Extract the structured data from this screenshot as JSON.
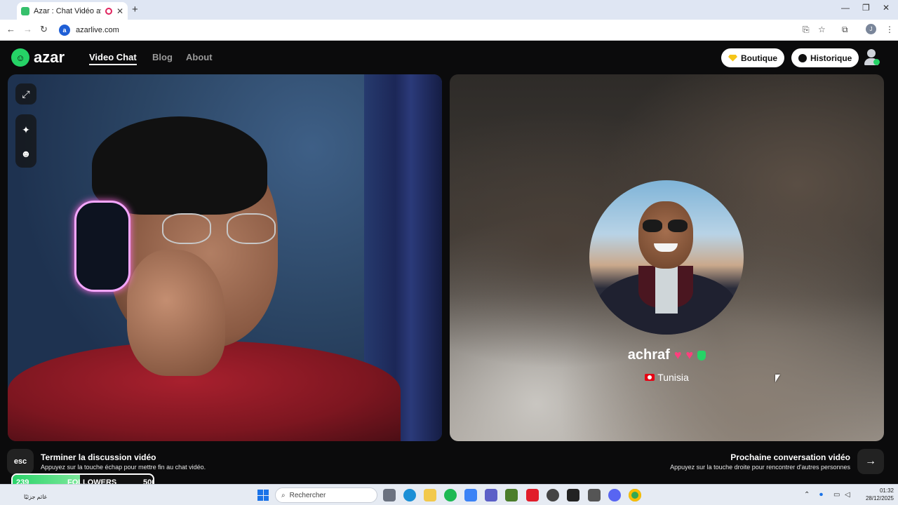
{
  "browser": {
    "tab_title": "Azar : Chat Vidéo avec de",
    "url": "azarlive.com",
    "site_icon_letter": "a"
  },
  "header": {
    "logo_text": "azar",
    "nav": [
      {
        "label": "Video Chat",
        "active": true
      },
      {
        "label": "Blog",
        "active": false
      },
      {
        "label": "About",
        "active": false
      }
    ],
    "shop_label": "Boutique",
    "history_label": "Historique"
  },
  "peer": {
    "name": "achraf",
    "hearts": [
      "♥",
      "♥"
    ],
    "country": "Tunisia"
  },
  "hints": {
    "esc_key": "esc",
    "end_title": "Terminer la discussion vidéo",
    "end_sub": "Appuyez sur la touche échap pour mettre fin au chat vidéo.",
    "next_title": "Prochaine conversation vidéo",
    "next_sub": "Appuyez sur la touche droite pour rencontrer d'autres personnes"
  },
  "followers_widget": {
    "current": "239",
    "label": "FOLLOWERS",
    "goal": "500",
    "progress_fraction": 0.478
  },
  "taskbar": {
    "weather": "غائم جزئيًا",
    "search_placeholder": "Rechercher",
    "time": "01:32",
    "date": "28/12/2025"
  },
  "colors": {
    "brand_green": "#25d366",
    "heart_pink": "#ff3e7d",
    "hoodie_red": "#a8202e"
  },
  "icons": {
    "fullscreen": "expand-icon",
    "effects": "sparkle-icon",
    "stickers": "smiley-icon",
    "next": "arrow-right-icon"
  }
}
